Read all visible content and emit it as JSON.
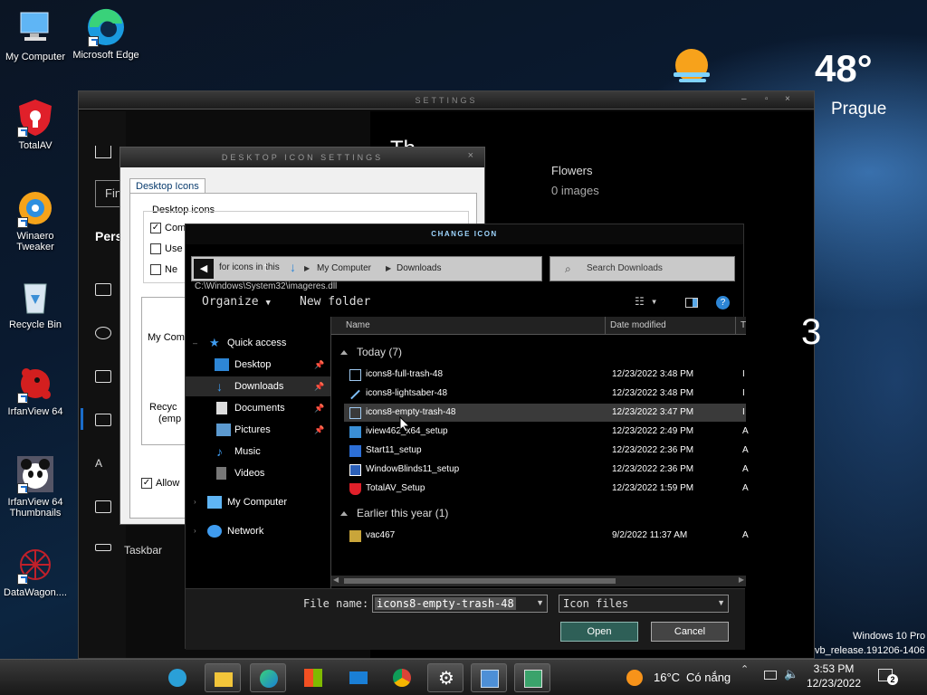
{
  "desktop": {
    "icons": [
      {
        "label": "My Computer"
      },
      {
        "label": "Microsoft Edge"
      },
      {
        "label": "TotalAV"
      },
      {
        "label": "Winaero Tweaker"
      },
      {
        "label": "Recycle Bin"
      },
      {
        "label": "IrfanView 64"
      },
      {
        "label": "IrfanView 64 Thumbnails"
      },
      {
        "label": "DataWagon...."
      }
    ]
  },
  "weather_widget": {
    "temp": "48°",
    "city": "Prague"
  },
  "settings_window": {
    "title": "SETTINGS",
    "search_partial": "Fin",
    "section_partial": "Pers",
    "right_heading_partial": "Th",
    "gallery_name": "Flowers",
    "gallery_count": "0 images",
    "right_digit": "3",
    "taskbar_partial": "Taskbar"
  },
  "desktop_icon_settings": {
    "title": "DESKTOP ICON SETTINGS",
    "tab": "Desktop Icons",
    "group_label": "Desktop icons",
    "checkboxes": [
      {
        "label": "Com",
        "checked": true
      },
      {
        "label": "Use",
        "checked": false
      },
      {
        "label": "Ne",
        "checked": false
      }
    ],
    "preview_items": [
      {
        "label": "My Com"
      },
      {
        "label": "Recyc"
      },
      {
        "label": "(emp"
      }
    ],
    "allow_label": "Allow",
    "path_partial": "for icons in this",
    "path_value": "C:\\Windows\\System32\\imageres.dll"
  },
  "change_icon": {
    "title": "CHANGE ICON",
    "breadcrumb": [
      "My Computer",
      "Downloads"
    ],
    "search_placeholder": "Search Downloads",
    "organize": "Organize",
    "new_folder": "New folder",
    "nav": [
      {
        "label": "Quick access"
      },
      {
        "label": "Desktop"
      },
      {
        "label": "Downloads"
      },
      {
        "label": "Documents"
      },
      {
        "label": "Pictures"
      },
      {
        "label": "Music"
      },
      {
        "label": "Videos"
      },
      {
        "label": "My Computer"
      },
      {
        "label": "Network"
      }
    ],
    "columns": {
      "name": "Name",
      "date": "Date modified",
      "type": "T"
    },
    "groups": [
      {
        "label": "Today (7)",
        "files": [
          {
            "name": "icons8-full-trash-48",
            "date": "12/23/2022 3:48 PM",
            "type": "I"
          },
          {
            "name": "icons8-lightsaber-48",
            "date": "12/23/2022 3:48 PM",
            "type": "I"
          },
          {
            "name": "icons8-empty-trash-48",
            "date": "12/23/2022 3:47 PM",
            "type": "I"
          },
          {
            "name": "iview462_x64_setup",
            "date": "12/23/2022 2:49 PM",
            "type": "A"
          },
          {
            "name": "Start11_setup",
            "date": "12/23/2022 2:36 PM",
            "type": "A"
          },
          {
            "name": "WindowBlinds11_setup",
            "date": "12/23/2022 2:36 PM",
            "type": "A"
          },
          {
            "name": "TotalAV_Setup",
            "date": "12/23/2022 1:59 PM",
            "type": "A"
          }
        ]
      },
      {
        "label": "Earlier this year (1)",
        "files": [
          {
            "name": "vac467",
            "date": "9/2/2022 11:37 AM",
            "type": "A"
          }
        ]
      }
    ],
    "file_name_label": "File name:",
    "file_name_value": "icons8-empty-trash-48",
    "file_type": "Icon files",
    "open": "Open",
    "cancel": "Cancel"
  },
  "watermark": {
    "line1": "Windows 10 Pro",
    "line2": "vb_release.191206-1406"
  },
  "taskbar": {
    "weather_temp": "16°C",
    "weather_text": "Có nắng",
    "time": "3:53 PM",
    "date": "12/23/2022",
    "notification_count": "2",
    "apps": [
      "media-player-icon",
      "file-explorer-icon",
      "edge-icon",
      "store-icon",
      "mail-icon",
      "chrome-icon",
      "settings-icon",
      "control-panel-icon",
      "display-settings-icon"
    ]
  },
  "colors": {
    "accent_blue": "#1a6cc9",
    "selection": "#3a3a3a",
    "open_button": "#2e5f57"
  }
}
